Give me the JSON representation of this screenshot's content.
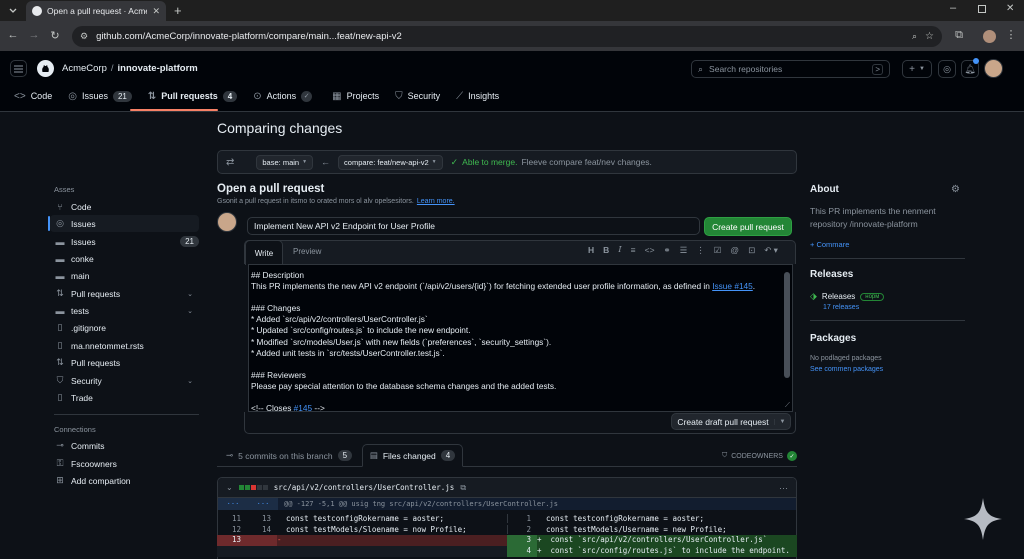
{
  "browser": {
    "tab_title": "Open a pull request · AcmeC",
    "url": "github.com/AcmeCorp/innovate-platform/compare/main...feat/new-api-v2"
  },
  "header": {
    "owner": "AcmeCorp",
    "separator": "/",
    "repo": "innovate-platform",
    "search_placeholder": "Search repositories",
    "plus_label": "+"
  },
  "repo_tabs": [
    {
      "label": "Code",
      "icon": "code-icon"
    },
    {
      "label": "Issues",
      "icon": "issue-icon",
      "count": "21"
    },
    {
      "label": "Pull requests",
      "icon": "pull-request-icon",
      "count": "4"
    },
    {
      "label": "Actions",
      "icon": "play-icon"
    },
    {
      "label": "Projects",
      "icon": "table-icon"
    },
    {
      "label": "Security",
      "icon": "shield-icon"
    },
    {
      "label": "Insights",
      "icon": "graph-icon"
    }
  ],
  "sidebar": {
    "heading": "Asses",
    "items": [
      {
        "label": "Code",
        "icon": "branch-icon"
      },
      {
        "label": "Issues",
        "icon": "issue-icon"
      },
      {
        "label": "Issues",
        "icon": "folder-icon",
        "count": "21"
      },
      {
        "label": "conke",
        "icon": "folder-icon"
      },
      {
        "label": "main",
        "icon": "folder-icon"
      },
      {
        "label": "Pull requests",
        "icon": "pull-request-icon"
      },
      {
        "label": "tests",
        "icon": "folder-icon"
      },
      {
        "label": ".gitignore",
        "icon": "file-icon"
      },
      {
        "label": "ma.nnetommet.rsts",
        "icon": "file-icon"
      },
      {
        "label": "Pull requests",
        "icon": "pull-request-icon"
      },
      {
        "label": "Security",
        "icon": "shield-icon"
      },
      {
        "label": "Trade",
        "icon": "file-icon"
      }
    ],
    "connections_heading": "Connections",
    "connections": [
      {
        "label": "Commits",
        "icon": "commit-icon"
      },
      {
        "label": "Fscoowners",
        "icon": "key-icon"
      },
      {
        "label": "Add compartion",
        "icon": "plus-box-icon"
      }
    ]
  },
  "compare": {
    "title": "Comparing changes",
    "base_label": "base: main",
    "compare_label": "compare: feat/new-api-v2",
    "merge_status": "Able to merge.",
    "merge_note": "Fleeve compare feat/nev changes."
  },
  "pr_form": {
    "heading": "Open a pull request",
    "subtext": "Gsonit a pull request in itsmo to orated mors ol alv opelsesitors.",
    "learn_more": "Learn more.",
    "title_value": "Implement New API v2 Endpoint for User Profile",
    "create_button": "Create pull request",
    "tab_write": "Write",
    "tab_preview": "Preview",
    "body_lines": [
      {
        "text": "## Description"
      },
      {
        "text": "This PR implements the new API v2 endpoint (`/api/v2/users/{id}`) for fetching extended user profile information, as defined in ",
        "link": "Issue #145",
        "after": "."
      },
      {
        "text": ""
      },
      {
        "text": "### Changes"
      },
      {
        "text": "* Added `src/api/v2/controllers/UserController.js`"
      },
      {
        "text": "* Updated `src/config/routes.js` to include the new endpoint."
      },
      {
        "text": "* Modified `src/models/User.js` with new fields (`preferences`, `security_settings`)."
      },
      {
        "text": "* Added unit tests in `src/tests/UserController.test.js`."
      },
      {
        "text": ""
      },
      {
        "text": "### Reviewers"
      },
      {
        "text": "Please pay special attention to the database schema changes and the added tests."
      },
      {
        "text": ""
      },
      {
        "text": "<!-- Closes ",
        "link": "#145",
        "after": " -->"
      }
    ],
    "draft_button": "Create draft pull request"
  },
  "files_tabs": {
    "commits_label": "5 commits on this branch",
    "commits_count": "5",
    "files_label": "Files changed",
    "files_count": "4",
    "codeowners": "CODEOWNERS"
  },
  "diff": {
    "file_path": "src/api/v2/controllers/UserController.js",
    "hunk_left": "...",
    "hunk_left2": "...",
    "hunk": "@@ -127 -5,1 @@ usig tng src/api/v2/controllers/UserController.js",
    "rows": [
      {
        "l1": "11",
        "l2": "13",
        "lt": "  const testconfigRokername = aoster;",
        "r1": "1",
        "rt": "  const testconfigRokername = aoster;",
        "type": "ctx"
      },
      {
        "l1": "12",
        "l2": "14",
        "lt": "  const testModels/Sloename = now Profile;",
        "r1": "2",
        "rt": "  const testModels/Username = new Profile;",
        "type": "ctx"
      },
      {
        "l1": "13",
        "l2": "",
        "lt": "-",
        "r1": "3",
        "rt": "+  const `src/api/v2/controllers/UserController.js`",
        "type": "mix"
      },
      {
        "l1": "",
        "l2": "",
        "lt": "",
        "r1": "4",
        "rt": "+  const `src/config/routes.js` to include the endpoint.",
        "type": "mix"
      }
    ]
  },
  "about": {
    "title": "About",
    "description": "This PR implements the nenment repository /innovate-platform",
    "link": "+ Commare",
    "releases_title": "Releases",
    "release_name": "Releases",
    "release_badge": "норм",
    "release_count": "17 releases",
    "packages_title": "Packages",
    "packages_text": "No podlaged packages",
    "packages_link": "See commen packages"
  },
  "colors": {
    "accent": "#4493f8",
    "green": "#238636",
    "background": "#0d1117"
  }
}
